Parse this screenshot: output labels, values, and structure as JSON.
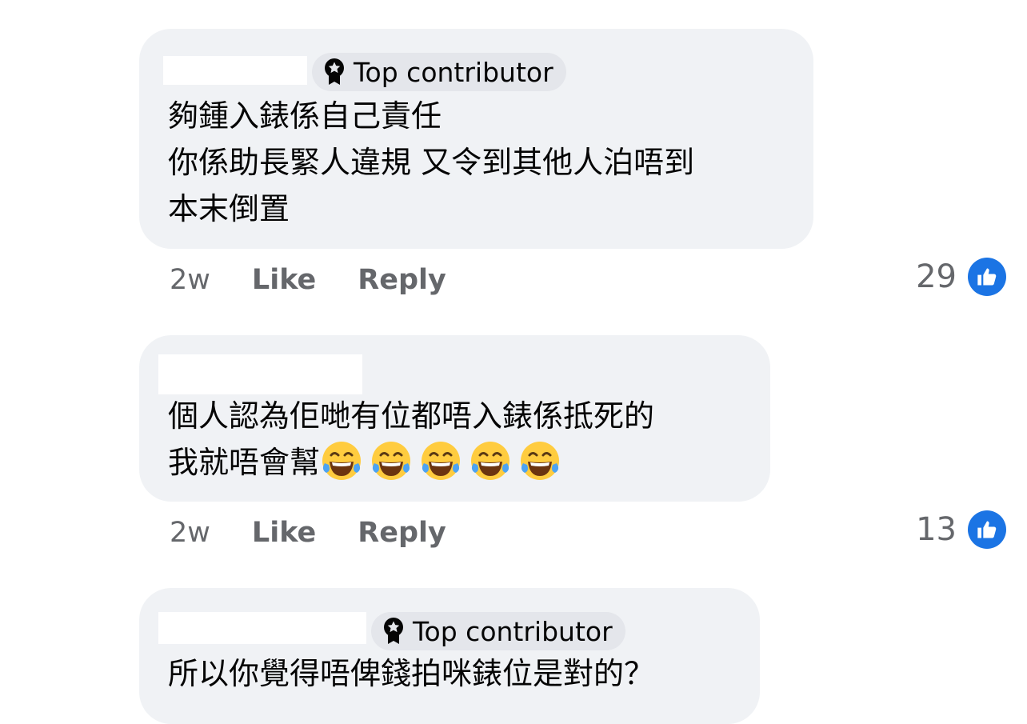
{
  "comments": [
    {
      "badge": "Top contributor",
      "lines": [
        "夠鍾入錶係自己責任",
        "你係助長緊人違規 又令到其他人泊唔到",
        "本末倒置"
      ],
      "time": "2w",
      "like_label": "Like",
      "reply_label": "Reply",
      "reaction_count": "29"
    },
    {
      "lines": [
        "個人認為佢哋有位都唔入錶係抵死的",
        "我就唔會幫"
      ],
      "emoji": "face-with-tears-of-joy",
      "emoji_count": 5,
      "time": "2w",
      "like_label": "Like",
      "reply_label": "Reply",
      "reaction_count": "13"
    },
    {
      "badge": "Top contributor",
      "lines": [
        "所以你覺得唔俾錢拍咪錶位是對的？"
      ]
    }
  ],
  "colors": {
    "bubble": "#f0f2f5",
    "badge": "#e4e6eb",
    "meta_text": "#65676b",
    "like_blue": "#1b74e4"
  }
}
